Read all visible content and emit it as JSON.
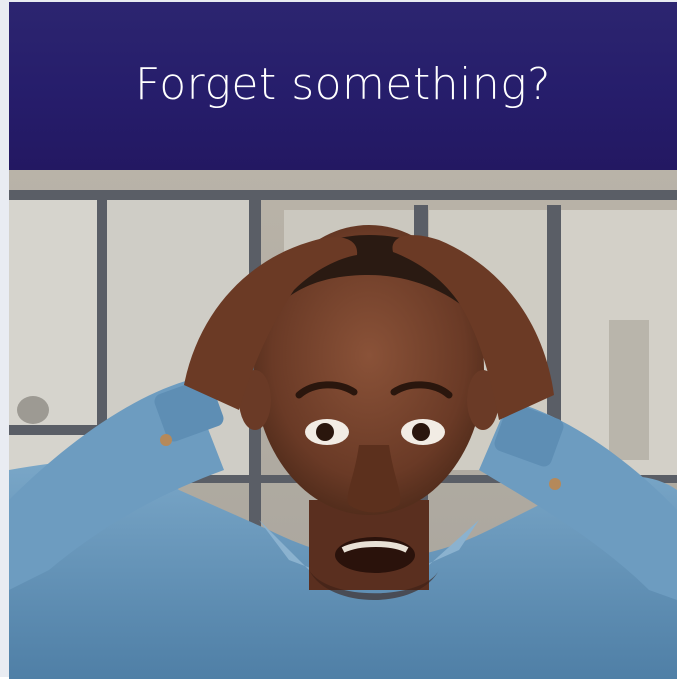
{
  "banner": {
    "title": "Forget something?"
  },
  "photo": {
    "icon": "surprised-man-photo"
  },
  "colors": {
    "banner_top": "#2c2570",
    "banner_bottom": "#231862",
    "shirt": "#5f8fb4"
  }
}
